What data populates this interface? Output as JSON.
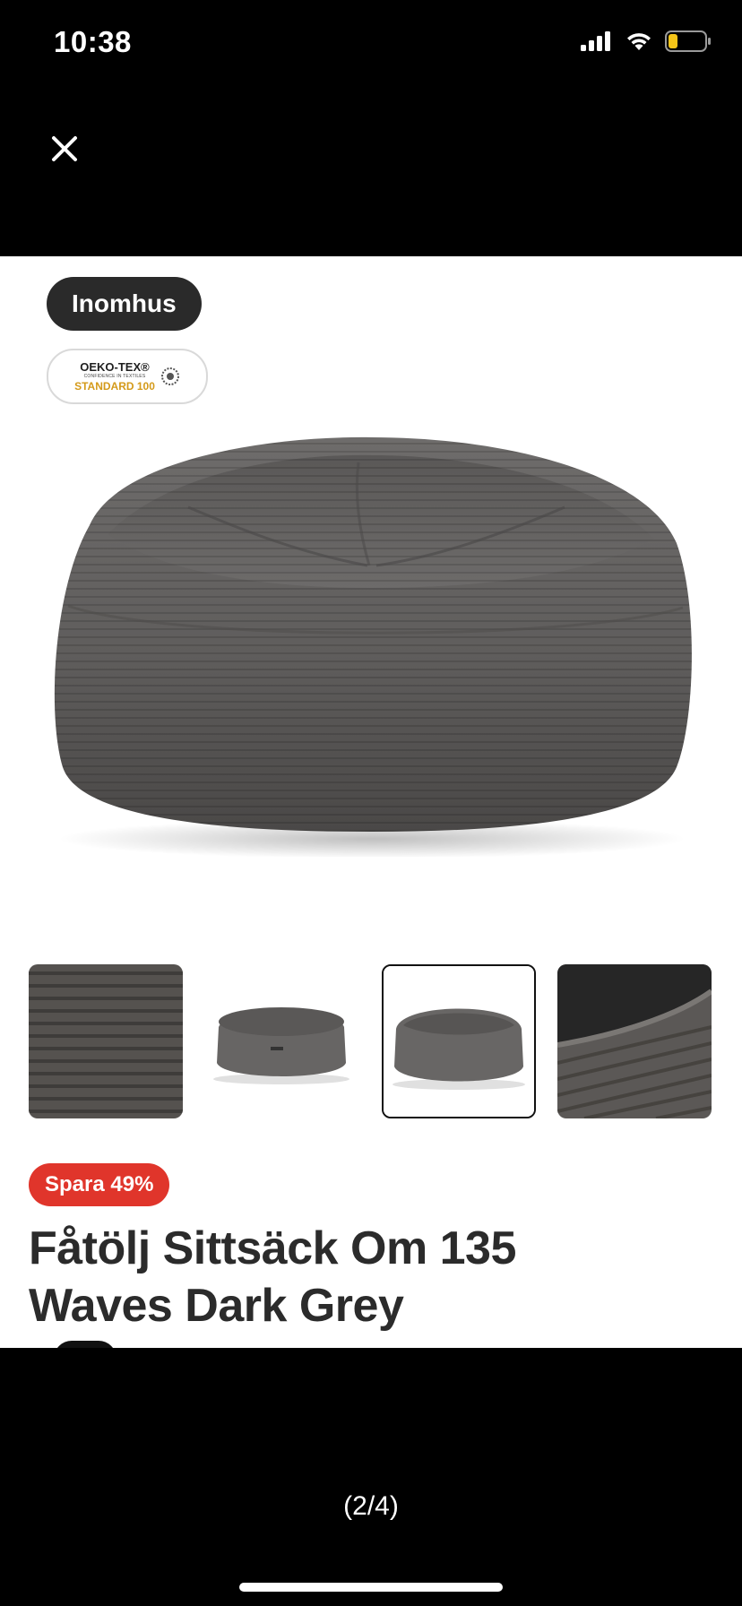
{
  "status_bar": {
    "time": "10:38",
    "icons": [
      "signal-icon",
      "wifi-icon",
      "battery-icon"
    ],
    "battery_color": "#f5c518"
  },
  "viewer": {
    "close_icon": "close-icon",
    "page_indicator": "(2/4)"
  },
  "product": {
    "tag": "Inomhus",
    "certification": {
      "name": "OEKO-TEX®",
      "tagline": "CONFIDENCE IN TEXTILES",
      "standard": "STANDARD 100"
    },
    "thumbnails": [
      {
        "name": "fabric-closeup",
        "selected": false
      },
      {
        "name": "bean-bag-side",
        "selected": false
      },
      {
        "name": "bean-bag-front",
        "selected": true
      },
      {
        "name": "fabric-leather-detail",
        "selected": false
      }
    ],
    "discount_label": "Spara 49%",
    "title": "Fåtölj Sittsäck Om 135 Waves Dark Grey"
  },
  "colors": {
    "discount": "#e0352b",
    "tag_bg": "#2a2a2a",
    "product_grey": "#666666"
  }
}
